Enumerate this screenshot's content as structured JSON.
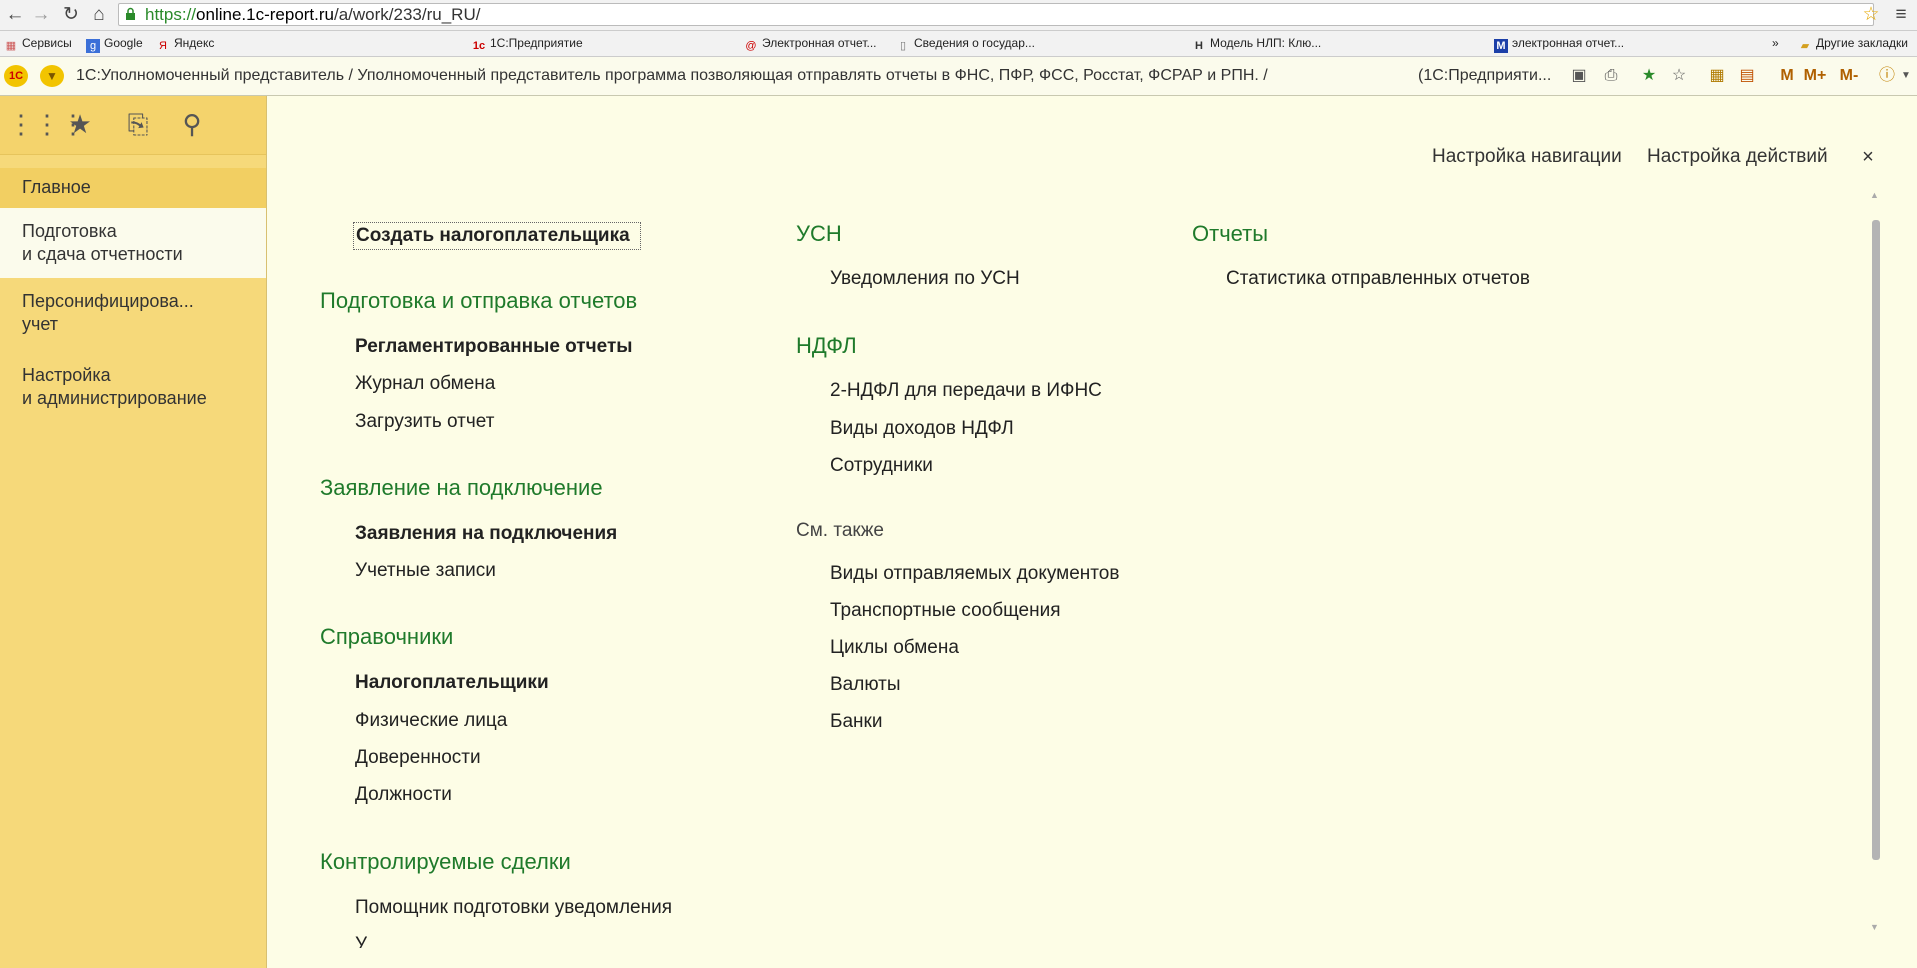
{
  "browser": {
    "url_scheme": "https://",
    "url_host": "online.1c-report.ru",
    "url_path": "/a/work/233/ru_RU/",
    "bookmarks": [
      {
        "label": "Сервисы",
        "icon": "apps-grid-icon"
      },
      {
        "label": "Google",
        "icon": "google-icon"
      },
      {
        "label": "Яндекс",
        "icon": "yandex-icon"
      },
      {
        "label": "1С:Предприятие",
        "icon": "1c-icon"
      },
      {
        "label": "Электронная отчет...",
        "icon": "at-icon"
      },
      {
        "label": "Сведения о государ...",
        "icon": "page-icon"
      },
      {
        "label": "Модель НЛП: Клю...",
        "icon": "nlp-icon"
      },
      {
        "label": "электронная отчет...",
        "icon": "m-icon"
      }
    ],
    "more_bookmarks": "»",
    "other_bookmarks": "Другие закладки"
  },
  "app": {
    "title": "1С:Уполномоченный представитель / Уполномоченный представитель программа позволяющая отправлять отчеты в ФНС, ПФР, ФСС, Росстат, ФСРАР и РПН. /",
    "title_suffix": "(1С:Предприяти...",
    "toolbar_m": "M",
    "toolbar_m_plus": "M+",
    "toolbar_m_minus": "M-"
  },
  "sidebar": {
    "sections": [
      {
        "line1": "Главное",
        "line2": ""
      },
      {
        "line1": "Подготовка",
        "line2": "и сдача отчетности"
      },
      {
        "line1": "Персонифицирова...",
        "line2": "учет"
      },
      {
        "line1": "Настройка",
        "line2": "и администрирование"
      }
    ]
  },
  "panel": {
    "nav_settings": "Настройка навигации",
    "action_settings": "Настройка действий",
    "close": "×"
  },
  "content": {
    "create_taxpayer": "Создать налогоплательщика",
    "groups": {
      "reports": {
        "title": "Подготовка и отправка отчетов",
        "items": [
          "Регламентированные отчеты",
          "Журнал обмена",
          "Загрузить отчет"
        ]
      },
      "application": {
        "title": "Заявление на подключение",
        "items": [
          "Заявления на подключения",
          "Учетные записи"
        ]
      },
      "directories": {
        "title": "Справочники",
        "items": [
          "Налогоплательщики",
          "Физические лица",
          "Доверенности",
          "Должности"
        ]
      },
      "controlled": {
        "title": "Контролируемые сделки",
        "items": [
          "Помощник подготовки уведомления",
          "У"
        ]
      },
      "usn": {
        "title": "УСН",
        "items": [
          "Уведомления по УСН"
        ]
      },
      "ndfl": {
        "title": "НДФЛ",
        "items": [
          "2-НДФЛ для передачи в ИФНС",
          "Виды доходов НДФЛ",
          "Сотрудники"
        ]
      },
      "see_also": {
        "title": "См. также",
        "items": [
          "Виды отправляемых документов",
          "Транспортные сообщения",
          "Циклы обмена",
          "Валюты",
          "Банки"
        ]
      },
      "stats": {
        "title": "Отчеты",
        "items": [
          "Статистика отправленных отчетов"
        ]
      }
    }
  },
  "colors": {
    "sidebar_bg": "#f6d97a",
    "content_bg": "#fdfde6",
    "group_title": "#1f7a2b"
  }
}
